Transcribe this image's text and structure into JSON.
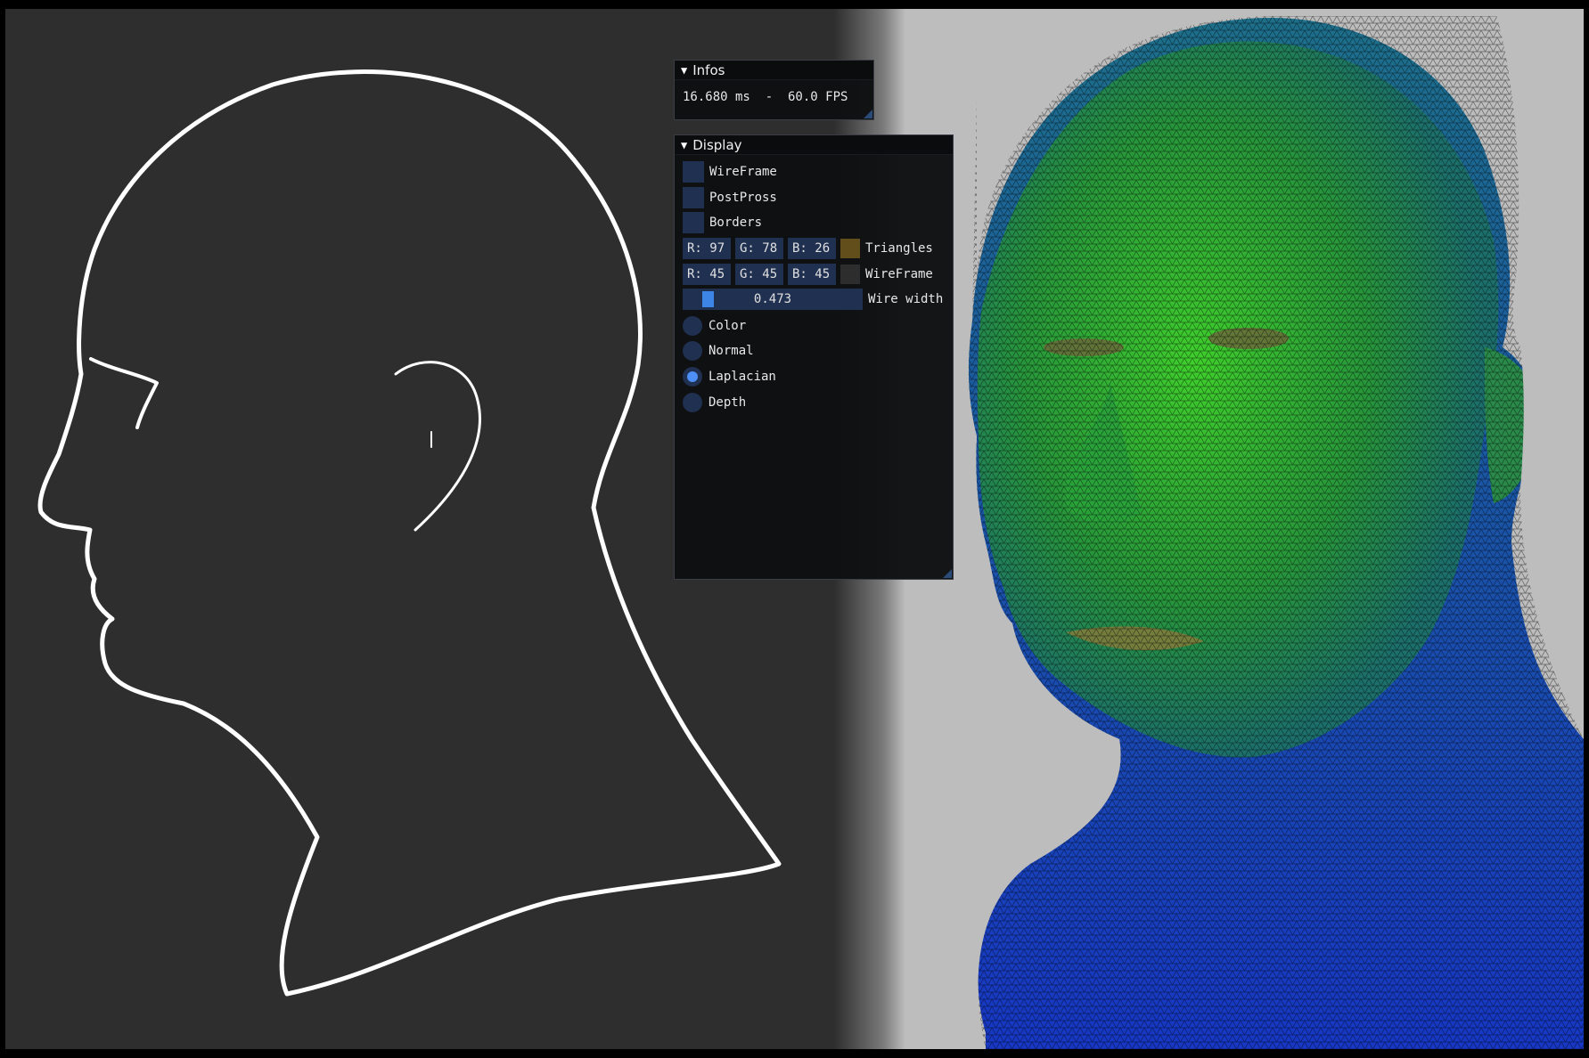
{
  "infos": {
    "title": "Infos",
    "fps_text": "16.680 ms  -  60.0 FPS"
  },
  "display": {
    "title": "Display",
    "checkboxes": [
      {
        "label": "WireFrame",
        "checked": false
      },
      {
        "label": "PostPross",
        "checked": false
      },
      {
        "label": "Borders",
        "checked": false
      }
    ],
    "triangles_color": {
      "r": "R: 97",
      "g": "G: 78",
      "b": "B: 26",
      "label": "Triangles",
      "swatch": "#614e1a"
    },
    "wireframe_color": {
      "r": "R: 45",
      "g": "G: 45",
      "b": "B: 45",
      "label": "WireFrame",
      "swatch": "#2d2d2d"
    },
    "wire_width": {
      "value_text": "0.473",
      "value": 0.473,
      "label": "Wire width"
    },
    "render_modes": [
      {
        "label": "Color",
        "selected": false
      },
      {
        "label": "Normal",
        "selected": false
      },
      {
        "label": "Laplacian",
        "selected": true
      },
      {
        "label": "Depth",
        "selected": false
      }
    ]
  },
  "colors": {
    "accent": "#4d8ef7",
    "widget_bg": "#1f3050",
    "left_background": "#2e2e2e",
    "right_background": "#bdbdbd",
    "mesh_green": "#2fae2c",
    "mesh_blue": "#1a3ec8"
  }
}
